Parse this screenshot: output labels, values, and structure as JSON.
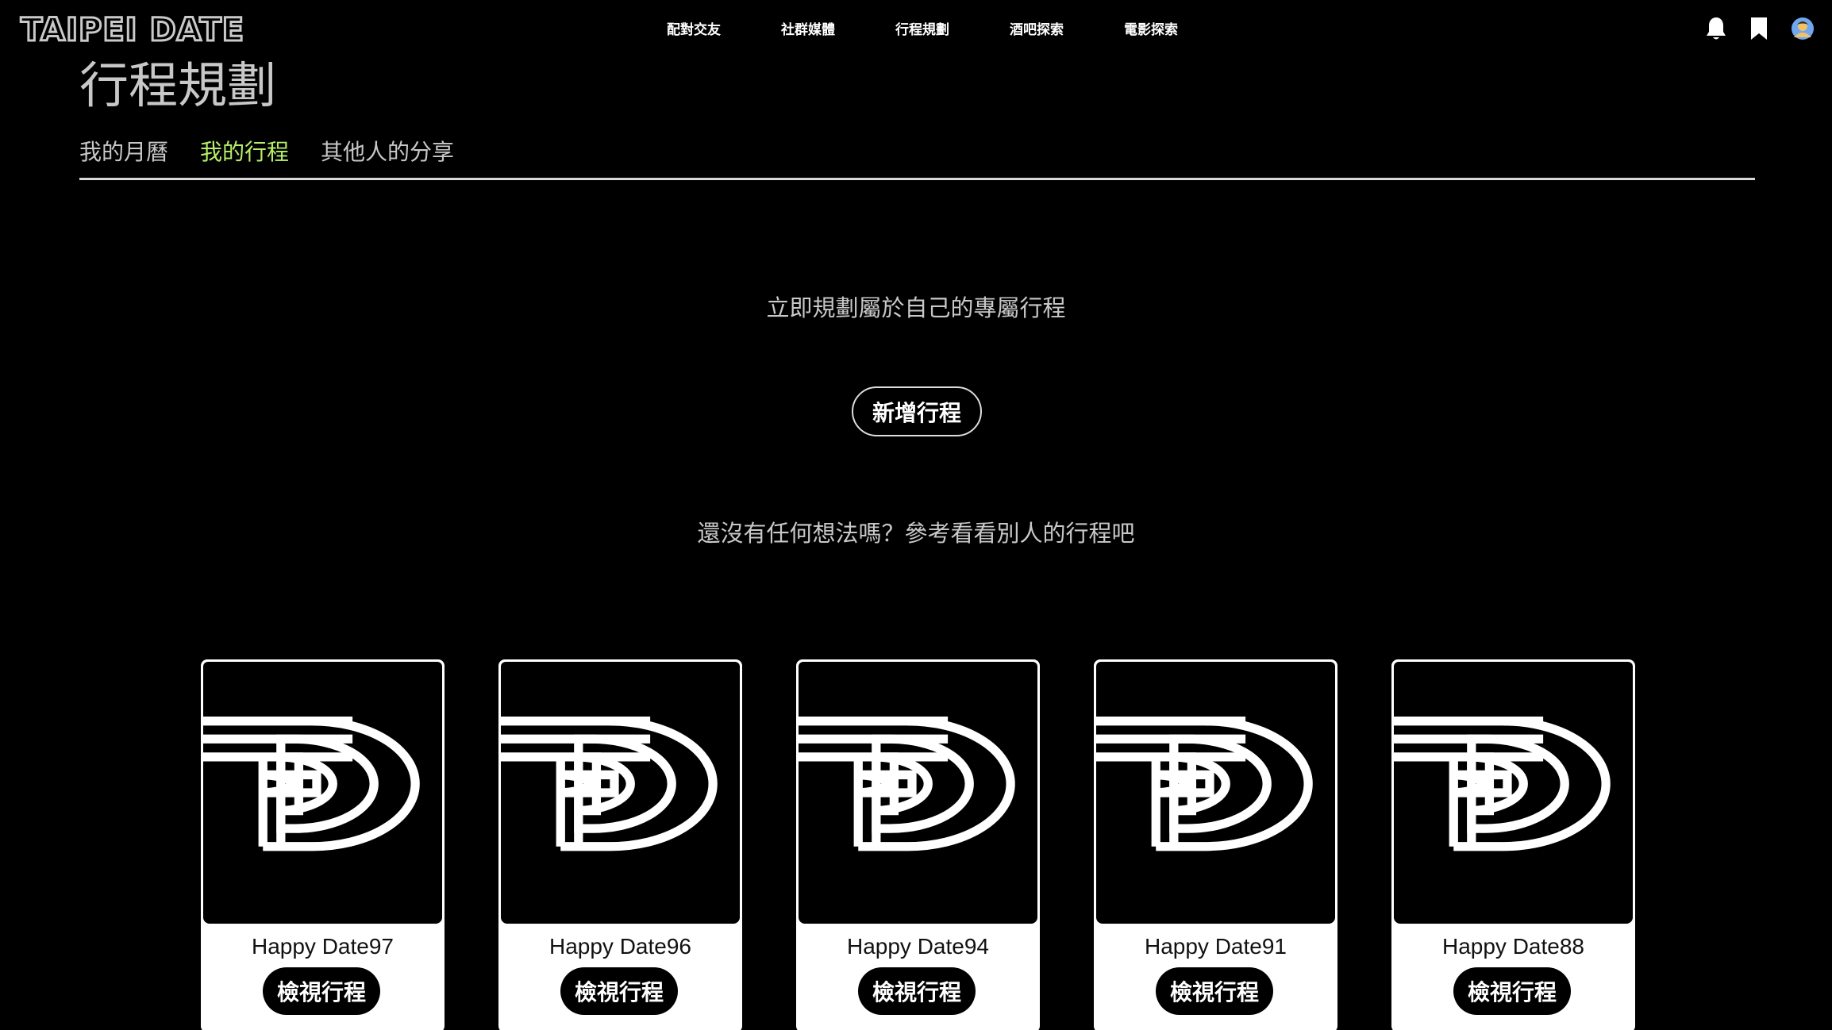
{
  "nav": {
    "brand": "TAIPEI DATE",
    "links": [
      "配對交友",
      "社群媒體",
      "行程規劃",
      "酒吧探索",
      "電影探索"
    ],
    "icons": [
      "bell-icon",
      "bookmark-icon",
      "avatar"
    ]
  },
  "header": {
    "title": "行程規劃",
    "tabs": [
      {
        "label": "我的月曆",
        "active": false
      },
      {
        "label": "我的行程",
        "active": true
      },
      {
        "label": "其他人的分享",
        "active": false
      }
    ]
  },
  "main": {
    "prompt_plan": "立即規劃屬於自己的專屬行程",
    "new_button": "新增行程",
    "prompt_explore": "還沒有任何想法嗎？參考看看別人的行程吧"
  },
  "cards": [
    {
      "name": "Happy Date97",
      "button": "檢視行程"
    },
    {
      "name": "Happy Date96",
      "button": "檢視行程"
    },
    {
      "name": "Happy Date94",
      "button": "檢視行程"
    },
    {
      "name": "Happy Date91",
      "button": "檢視行程"
    },
    {
      "name": "Happy Date88",
      "button": "檢視行程"
    }
  ],
  "colors": {
    "background": "#000000",
    "active_tab": "#b8ef6a",
    "muted_text": "#c8c8c8",
    "card_bg": "#ffffff"
  }
}
